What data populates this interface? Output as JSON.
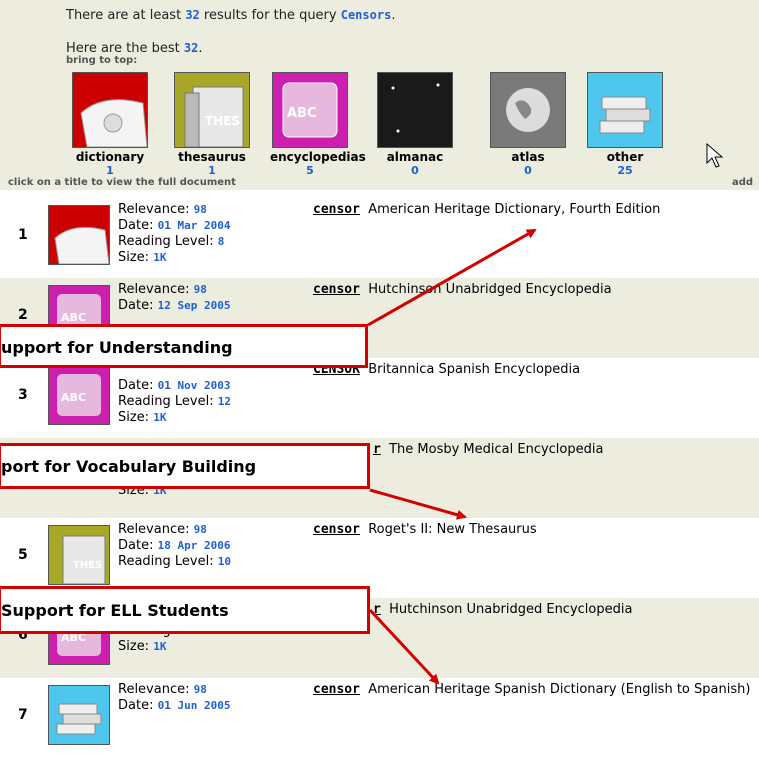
{
  "header": {
    "results_prefix": "There are at least",
    "results_count": "32",
    "results_mid": "results for the query",
    "query": "Censors",
    "results_suffix": ".",
    "best_prefix": "Here are the best",
    "best_count": "32",
    "best_suffix": ".",
    "bring_to_top": "bring to top:",
    "click_hint": "click on a title to view the full document",
    "add_text": "add"
  },
  "categories": [
    {
      "label": "dictionary",
      "count": "1",
      "color": "#cc0000"
    },
    {
      "label": "thesaurus",
      "count": "1",
      "color": "#a8a828"
    },
    {
      "label": "encyclopedias",
      "count": "5",
      "color": "#cc1fb0"
    },
    {
      "label": "almanac",
      "count": "0",
      "color": "#1a1a1a"
    },
    {
      "label": "atlas",
      "count": "0",
      "color": "#7a7a7a"
    },
    {
      "label": "other",
      "count": "25",
      "color": "#4fc6ee"
    }
  ],
  "labels": {
    "relevance": "Relevance:",
    "date": "Date:",
    "reading_level": "Reading Level:",
    "size": "Size:"
  },
  "results": [
    {
      "num": "1",
      "relevance": "98",
      "date": "01 Mar 2004",
      "reading_level": "8",
      "size": "1K",
      "term": "censor",
      "source": "American Heritage Dictionary, Fourth Edition",
      "kind": "dictionary"
    },
    {
      "num": "2",
      "relevance": "98",
      "date": "12 Sep 2005",
      "term": "censor",
      "source": "Hutchinson Unabridged Encyclopedia",
      "kind": "encyclopedias"
    },
    {
      "num": "3",
      "reading_level": "12",
      "size": "1K",
      "date": "01 Nov 2003",
      "term": "CENSOR",
      "source": "Britannica Spanish Encyclopedia",
      "kind": "encyclopedias"
    },
    {
      "num": "",
      "size": "1K",
      "term": "r",
      "source": "The Mosby Medical Encyclopedia",
      "kind": "encyclopedias"
    },
    {
      "num": "5",
      "relevance": "98",
      "date": "18 Apr 2006",
      "reading_level": "10",
      "term": "censor",
      "source": "Roget's II: New Thesaurus",
      "kind": "thesaurus"
    },
    {
      "num": "6",
      "reading_level": "10",
      "size": "1K",
      "term": "r",
      "source": "Hutchinson Unabridged Encyclopedia",
      "kind": "encyclopedias"
    },
    {
      "num": "7",
      "relevance": "98",
      "date": "01 Jun 2005",
      "term": "censor",
      "source": "American Heritage Spanish Dictionary (English to Spanish)",
      "kind": "other"
    }
  ],
  "callouts": {
    "understanding": "upport for Understanding",
    "vocabulary": "port for Vocabulary Building",
    "ell": "Support for ELL Students"
  },
  "colors": {
    "accent_blue": "#1f5fd6",
    "callout_red": "#d40000",
    "header_bg": "#ececdf"
  }
}
